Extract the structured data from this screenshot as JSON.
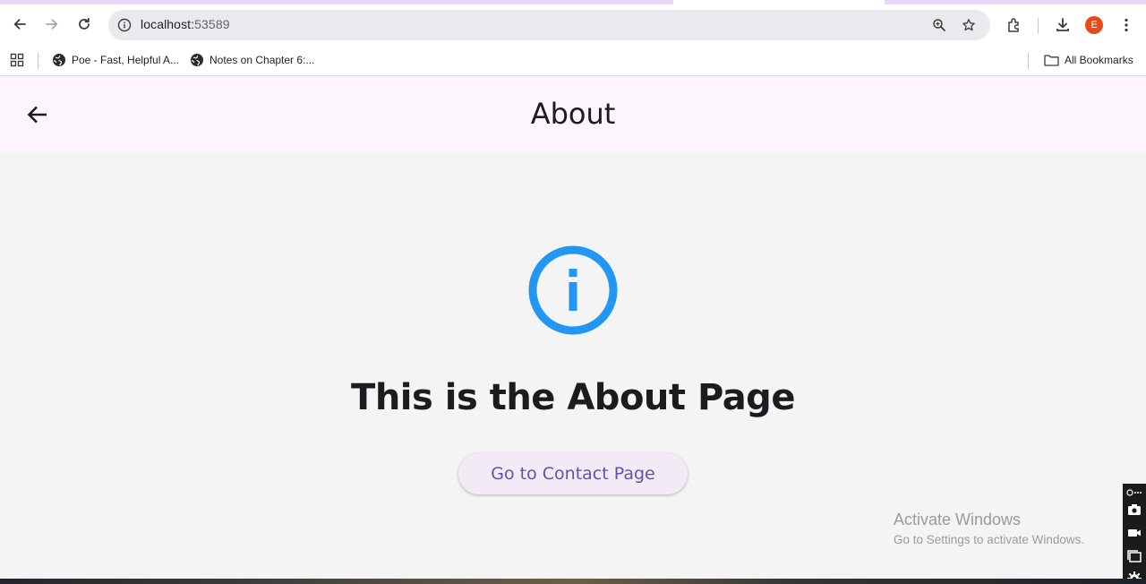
{
  "browser": {
    "url_host": "localhost:",
    "url_port": "53589",
    "profile_initial": "E",
    "bookmarks": [
      {
        "label": "Poe - Fast, Helpful A..."
      },
      {
        "label": "Notes on Chapter 6:..."
      }
    ],
    "all_bookmarks_label": "All Bookmarks"
  },
  "appbar": {
    "title": "About"
  },
  "main": {
    "heading": "This is the About Page",
    "button_label": "Go to Contact Page",
    "icon": "info-outline-icon",
    "accent_color": "#2196f3"
  },
  "watermark": {
    "line1": "Activate Windows",
    "line2": "Go to Settings to activate Windows."
  }
}
